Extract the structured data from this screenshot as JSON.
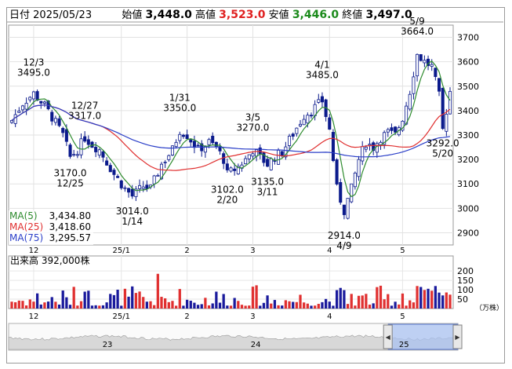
{
  "header": {
    "date_label": "日付",
    "date": "2025/05/23",
    "open_label": "始値",
    "open": "3,448.0",
    "high_label": "高値",
    "high": "3,523.0",
    "low_label": "安値",
    "low": "3,446.0",
    "close_label": "終値",
    "close": "3,497.0"
  },
  "colors": {
    "up": "#ffffff",
    "down": "#0b1a8c",
    "high": "#e02020",
    "low": "#1a8a1a",
    "ma5": "#2e8b2e",
    "ma25": "#e03030",
    "ma75": "#2b3fc8",
    "vol_up": "#e03030",
    "vol_down": "#1a1a9c"
  },
  "legend": [
    {
      "name": "MA(5)",
      "value": "3,434.80",
      "color": "#2e8b2e"
    },
    {
      "name": "MA(25)",
      "value": "3,418.60",
      "color": "#e03030"
    },
    {
      "name": "MA(75)",
      "value": "3,295.57",
      "color": "#2b3fc8"
    }
  ],
  "volume_label": "出来高",
  "volume_value": "392,000株",
  "volume_unit": "（万株）",
  "chart_data": {
    "type": "candlestick",
    "price_axis": {
      "ticks": [
        2900,
        3000,
        3100,
        3200,
        3300,
        3400,
        3500,
        3600,
        3700
      ],
      "range": [
        2850,
        3750
      ]
    },
    "volume_axis": {
      "ticks": [
        50,
        100,
        150,
        200
      ],
      "range": [
        0,
        230
      ]
    },
    "month_ticks": [
      {
        "label": "12",
        "day": 6
      },
      {
        "label": "25/1",
        "day": 30
      },
      {
        "label": "2",
        "day": 48
      },
      {
        "label": "3",
        "day": 66
      },
      {
        "label": "4",
        "day": 87
      },
      {
        "label": "5",
        "day": 107
      }
    ],
    "annotations": [
      {
        "day": 6,
        "price": 3495,
        "text": [
          "12/3",
          "3495.0"
        ],
        "pos": "above"
      },
      {
        "day": 20,
        "price": 3317,
        "text": [
          "12/27",
          "3317.0"
        ],
        "pos": "above"
      },
      {
        "day": 46,
        "price": 3350,
        "text": [
          "1/31",
          "3350.0"
        ],
        "pos": "above"
      },
      {
        "day": 66,
        "price": 3270,
        "text": [
          "3/5",
          "3270.0"
        ],
        "pos": "above"
      },
      {
        "day": 85,
        "price": 3485,
        "text": [
          "4/1",
          "3485.0"
        ],
        "pos": "above"
      },
      {
        "day": 111,
        "price": 3664,
        "text": [
          "5/9",
          "3664.0"
        ],
        "pos": "above"
      },
      {
        "day": 16,
        "price": 3170,
        "text": [
          "3170.0",
          "12/25"
        ],
        "pos": "below"
      },
      {
        "day": 33,
        "price": 3014,
        "text": [
          "3014.0",
          "1/14"
        ],
        "pos": "below"
      },
      {
        "day": 59,
        "price": 3102,
        "text": [
          "3102.0",
          "2/20"
        ],
        "pos": "below"
      },
      {
        "day": 70,
        "price": 3135,
        "text": [
          "3135.0",
          "3/11"
        ],
        "pos": "below"
      },
      {
        "day": 91,
        "price": 2914,
        "text": [
          "2914.0",
          "4/9"
        ],
        "pos": "below"
      },
      {
        "day": 118,
        "price": 3292,
        "text": [
          "3292.0",
          "5/20"
        ],
        "pos": "below"
      }
    ],
    "anchors": [
      {
        "day": 0,
        "price": 3360
      },
      {
        "day": 3,
        "price": 3430
      },
      {
        "day": 6,
        "price": 3470
      },
      {
        "day": 9,
        "price": 3420
      },
      {
        "day": 12,
        "price": 3350
      },
      {
        "day": 14,
        "price": 3300
      },
      {
        "day": 16,
        "price": 3210
      },
      {
        "day": 18,
        "price": 3240
      },
      {
        "day": 20,
        "price": 3290
      },
      {
        "day": 22,
        "price": 3260
      },
      {
        "day": 24,
        "price": 3240
      },
      {
        "day": 26,
        "price": 3190
      },
      {
        "day": 28,
        "price": 3140
      },
      {
        "day": 31,
        "price": 3080
      },
      {
        "day": 33,
        "price": 3050
      },
      {
        "day": 36,
        "price": 3090
      },
      {
        "day": 38,
        "price": 3080
      },
      {
        "day": 41,
        "price": 3180
      },
      {
        "day": 44,
        "price": 3240
      },
      {
        "day": 46,
        "price": 3320
      },
      {
        "day": 48,
        "price": 3300
      },
      {
        "day": 51,
        "price": 3240
      },
      {
        "day": 54,
        "price": 3270
      },
      {
        "day": 56,
        "price": 3250
      },
      {
        "day": 58,
        "price": 3200
      },
      {
        "day": 59,
        "price": 3140
      },
      {
        "day": 62,
        "price": 3170
      },
      {
        "day": 64,
        "price": 3200
      },
      {
        "day": 66,
        "price": 3240
      },
      {
        "day": 68,
        "price": 3210
      },
      {
        "day": 70,
        "price": 3180
      },
      {
        "day": 72,
        "price": 3210
      },
      {
        "day": 74,
        "price": 3230
      },
      {
        "day": 76,
        "price": 3280
      },
      {
        "day": 78,
        "price": 3330
      },
      {
        "day": 80,
        "price": 3380
      },
      {
        "day": 82,
        "price": 3400
      },
      {
        "day": 85,
        "price": 3440
      },
      {
        "day": 87,
        "price": 3320
      },
      {
        "day": 89,
        "price": 3080
      },
      {
        "day": 91,
        "price": 2990
      },
      {
        "day": 93,
        "price": 3080
      },
      {
        "day": 95,
        "price": 3200
      },
      {
        "day": 97,
        "price": 3270
      },
      {
        "day": 99,
        "price": 3250
      },
      {
        "day": 101,
        "price": 3290
      },
      {
        "day": 103,
        "price": 3310
      },
      {
        "day": 105,
        "price": 3300
      },
      {
        "day": 107,
        "price": 3370
      },
      {
        "day": 109,
        "price": 3480
      },
      {
        "day": 111,
        "price": 3630
      },
      {
        "day": 113,
        "price": 3600
      },
      {
        "day": 115,
        "price": 3580
      },
      {
        "day": 117,
        "price": 3460
      },
      {
        "day": 118,
        "price": 3320
      },
      {
        "day": 119,
        "price": 3400
      },
      {
        "day": 120,
        "price": 3480
      }
    ],
    "last_day": 120
  },
  "navigator": {
    "labels": [
      {
        "text": "23",
        "pos": 0.22
      },
      {
        "text": "24",
        "pos": 0.55
      },
      {
        "text": "25",
        "pos": 0.88
      }
    ],
    "window_start": 0.845,
    "window_end": 1.0,
    "left_arrow": "◀",
    "right_arrow": "▶"
  }
}
